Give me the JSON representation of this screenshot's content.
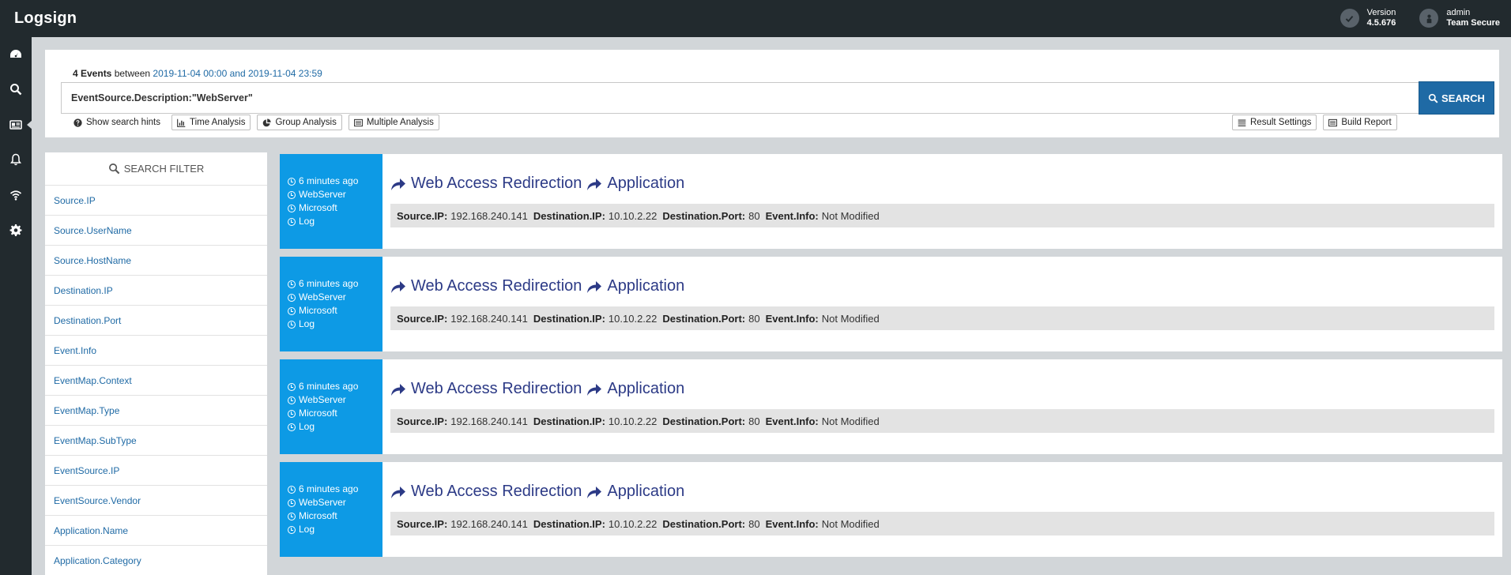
{
  "app": {
    "title": "Logsign"
  },
  "header": {
    "version_label": "Version",
    "version_value": "4.5.676",
    "user_name": "admin",
    "team_name": "Team Secure"
  },
  "rail": [
    "dashboard-icon",
    "search-icon",
    "news-icon",
    "bell-icon",
    "wifi-icon",
    "gear-icon"
  ],
  "search": {
    "events_count": "4 Events",
    "between": "between",
    "range": "2019-11-04 00:00 and 2019-11-04 23:59",
    "query": "EventSource.Description:\"WebServer\"",
    "button_label": "SEARCH",
    "hints_label": "Show search hints",
    "time_analysis": "Time Analysis",
    "group_analysis": "Group Analysis",
    "multiple_analysis": "Multiple Analysis",
    "result_settings": "Result Settings",
    "build_report": "Build Report"
  },
  "filter": {
    "header": "SEARCH FILTER",
    "items": [
      "Source.IP",
      "Source.UserName",
      "Source.HostName",
      "Destination.IP",
      "Destination.Port",
      "Event.Info",
      "EventMap.Context",
      "EventMap.Type",
      "EventMap.SubType",
      "EventSource.IP",
      "EventSource.Vendor",
      "Application.Name",
      "Application.Category"
    ]
  },
  "events": [
    {
      "time": "6 minutes ago",
      "source": "WebServer",
      "vendor": "Microsoft",
      "type": "Log",
      "title_main": "Web Access Redirection",
      "title_sub": "Application",
      "fields": [
        {
          "key": "Source.IP:",
          "value": "192.168.240.141"
        },
        {
          "key": "Destination.IP:",
          "value": "10.10.2.22"
        },
        {
          "key": "Destination.Port:",
          "value": "80"
        },
        {
          "key": "Event.Info:",
          "value": "Not Modified"
        }
      ]
    },
    {
      "time": "6 minutes ago",
      "source": "WebServer",
      "vendor": "Microsoft",
      "type": "Log",
      "title_main": "Web Access Redirection",
      "title_sub": "Application",
      "fields": [
        {
          "key": "Source.IP:",
          "value": "192.168.240.141"
        },
        {
          "key": "Destination.IP:",
          "value": "10.10.2.22"
        },
        {
          "key": "Destination.Port:",
          "value": "80"
        },
        {
          "key": "Event.Info:",
          "value": "Not Modified"
        }
      ]
    },
    {
      "time": "6 minutes ago",
      "source": "WebServer",
      "vendor": "Microsoft",
      "type": "Log",
      "title_main": "Web Access Redirection",
      "title_sub": "Application",
      "fields": [
        {
          "key": "Source.IP:",
          "value": "192.168.240.141"
        },
        {
          "key": "Destination.IP:",
          "value": "10.10.2.22"
        },
        {
          "key": "Destination.Port:",
          "value": "80"
        },
        {
          "key": "Event.Info:",
          "value": "Not Modified"
        }
      ]
    },
    {
      "time": "6 minutes ago",
      "source": "WebServer",
      "vendor": "Microsoft",
      "type": "Log",
      "title_main": "Web Access Redirection",
      "title_sub": "Application",
      "fields": [
        {
          "key": "Source.IP:",
          "value": "192.168.240.141"
        },
        {
          "key": "Destination.IP:",
          "value": "10.10.2.22"
        },
        {
          "key": "Destination.Port:",
          "value": "80"
        },
        {
          "key": "Event.Info:",
          "value": "Not Modified"
        }
      ]
    }
  ],
  "colors": {
    "topbar": "#222a2e",
    "accent_blue": "#1f6aa5",
    "event_meta_blue": "#0d9ae5",
    "title_navy": "#2c3a86",
    "background": "#d2d6d9"
  }
}
